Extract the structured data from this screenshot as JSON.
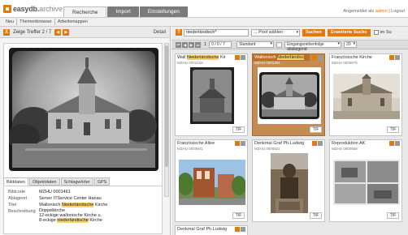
{
  "app": {
    "logo_name": "easydb.",
    "logo_suffix": "archive",
    "tabs": [
      "Recherche",
      "Import",
      "Einstellungen"
    ],
    "active_tab": "Recherche",
    "logged_in_prefix": "Angemeldet als",
    "user": "admin",
    "logout_label": "Logout"
  },
  "subnav": [
    "Neu",
    "Themenbrowser",
    "Arbeitsmappen"
  ],
  "left": {
    "close_label": "X",
    "hits_label": "Zeige Treffer 2 / 7",
    "detail_label": "Detail",
    "tabs": [
      "Bilddaten",
      "Objektdaten",
      "Schlagwörter",
      "GPS"
    ],
    "active_tab": "Bilddaten",
    "meta": {
      "bildcode_key": "Bildcode",
      "bildcode_val": "MZHU 0001461",
      "ablageort_key": "Ablageort",
      "ablageort_val": "Server ITService Center Hanau",
      "titel_key": "Titel",
      "titel_pre": "Wallonisch ",
      "titel_hl": "Niederländische",
      "titel_post": " Kirche",
      "beschreibung_key": "Beschreibung",
      "beschreibung_line1": "Doppelkirche",
      "beschreibung_line2": "12-eckige wallonische Kirche u.",
      "beschreibung_line3_pre": "8-eckige ",
      "beschreibung_line3_hl": "niederländische",
      "beschreibung_line3_post": " Kirche"
    }
  },
  "search": {
    "icon_label": "?",
    "query": "niederländisch*",
    "pool_placeholder": "... Pool wählen",
    "search_button": "Suchen",
    "extended_button": "Erweiterte Suche",
    "checkbox_label": "im Su"
  },
  "pager": {
    "page_num": "1",
    "range": "0 / 0 / 7",
    "view": "Standard",
    "sort": "Eingangsreihenfolge absteigend",
    "count": "20"
  },
  "results": [
    {
      "title_pre": "Wall ",
      "title_hl": "Niederländische",
      "title_post": " Kir",
      "id": "MZHU 0002126",
      "tif": "TIF",
      "selected": false
    },
    {
      "title_pre": "Wallonisch ",
      "title_hl": "Niederländisc",
      "title_post": "",
      "id": "MZHU 0001461",
      "tif": "TIF",
      "selected": true
    },
    {
      "title_pre": "Französische Kirche",
      "title_hl": "",
      "title_post": "",
      "id": "MZHU 0000975",
      "tif": "TIF",
      "selected": false
    },
    {
      "title_pre": "Französische Allee",
      "title_hl": "",
      "title_post": "",
      "id": "MZHU 0000941",
      "tif": "TIF",
      "selected": false
    },
    {
      "title_pre": "Denkmal Graf Ph.Ludwig",
      "title_hl": "",
      "title_post": "",
      "id": "MZHU 0000821",
      "tif": "TIF",
      "selected": false
    },
    {
      "title_pre": "Reproduktion AK",
      "title_hl": "",
      "title_post": "",
      "id": "MZHU 0000858",
      "tif": "TIF",
      "selected": false
    },
    {
      "title_pre": "Denkmal Graf Ph.Ludwig",
      "title_hl": "",
      "title_post": "",
      "id": "",
      "tif": "",
      "selected": false
    }
  ],
  "colors": {
    "accent": "#e2790e",
    "selected_card": "#c48b52",
    "highlight": "#f6d36b"
  }
}
